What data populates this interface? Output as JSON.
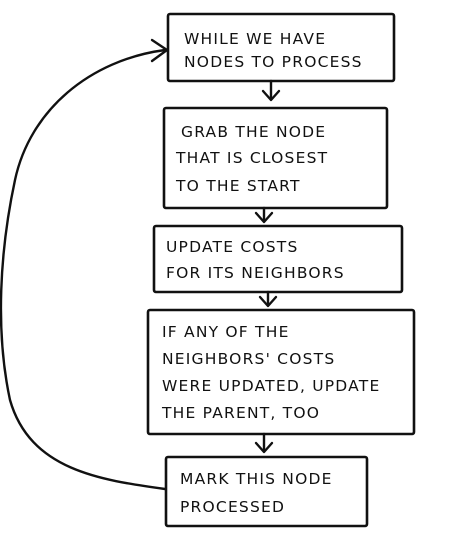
{
  "steps": [
    {
      "lines": [
        "WHILE WE HAVE",
        "NODES TO PROCESS"
      ]
    },
    {
      "lines": [
        "GRAB THE NODE",
        "THAT IS CLOSEST",
        "TO THE START"
      ]
    },
    {
      "lines": [
        "UPDATE COSTS",
        "FOR ITS NEIGHBORS"
      ]
    },
    {
      "lines": [
        "IF ANY OF THE",
        "NEIGHBORS' COSTS",
        "WERE UPDATED, UPDATE",
        "THE PARENT, TOO"
      ]
    },
    {
      "lines": [
        "MARK THIS NODE",
        "PROCESSED"
      ]
    }
  ],
  "colors": {
    "ink": "#111111",
    "background": "#ffffff"
  }
}
